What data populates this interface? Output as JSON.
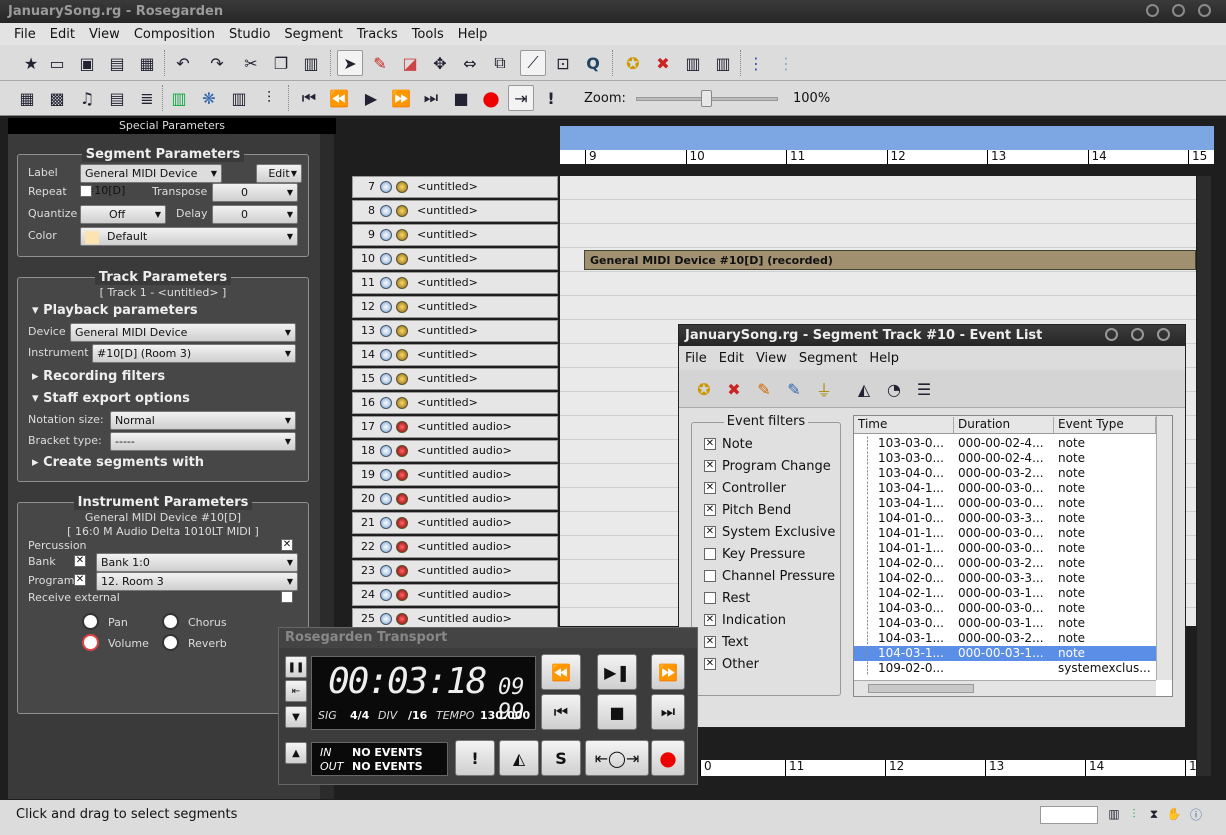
{
  "window": {
    "title": "JanuarySong.rg - Rosegarden"
  },
  "menu": [
    "File",
    "Edit",
    "View",
    "Composition",
    "Studio",
    "Segment",
    "Tracks",
    "Tools",
    "Help"
  ],
  "zoom": {
    "label": "Zoom:",
    "value": "100%",
    "level": 0.5
  },
  "left_panel": {
    "header": "Special Parameters",
    "segment": {
      "title": "Segment Parameters",
      "label_label": "Label",
      "label_value": "General MIDI Device #10[D]",
      "edit": "Edit",
      "repeat": "Repeat",
      "transpose": "Transpose",
      "transpose_value": "0",
      "quantize": "Quantize",
      "quantize_value": "Off",
      "delay": "Delay",
      "delay_value": "0",
      "color": "Color",
      "color_value": "Default"
    },
    "track": {
      "title": "Track Parameters",
      "subtitle": "[ Track 1 - <untitled> ]",
      "playback": "Playback parameters",
      "device": "Device",
      "device_value": "General MIDI Device",
      "instrument": "Instrument",
      "instrument_value": "#10[D] (Room 3)",
      "recording": "Recording filters",
      "staff": "Staff export options",
      "notation_size": "Notation size:",
      "notation_value": "Normal",
      "bracket_type": "Bracket type:",
      "bracket_value": "-----",
      "create": "Create segments with"
    },
    "instrument": {
      "title": "Instrument Parameters",
      "line1": "General MIDI Device  #10[D]",
      "line2": "[ 16:0 M Audio Delta 1010LT MIDI ]",
      "percussion": "Percussion",
      "bank": "Bank",
      "bank_value": "Bank 1:0",
      "program": "Program",
      "program_value": "12. Room 3",
      "receive": "Receive external",
      "pan": "Pan",
      "chorus": "Chorus",
      "volume": "Volume",
      "reverb": "Reverb"
    }
  },
  "tracks": [
    {
      "n": "7",
      "name": "<untitled>",
      "audio": false
    },
    {
      "n": "8",
      "name": "<untitled>",
      "audio": false
    },
    {
      "n": "9",
      "name": "<untitled>",
      "audio": false
    },
    {
      "n": "10",
      "name": "<untitled>",
      "audio": false
    },
    {
      "n": "11",
      "name": "<untitled>",
      "audio": false
    },
    {
      "n": "12",
      "name": "<untitled>",
      "audio": false
    },
    {
      "n": "13",
      "name": "<untitled>",
      "audio": false
    },
    {
      "n": "14",
      "name": "<untitled>",
      "audio": false
    },
    {
      "n": "15",
      "name": "<untitled>",
      "audio": false
    },
    {
      "n": "16",
      "name": "<untitled>",
      "audio": false
    },
    {
      "n": "17",
      "name": "<untitled audio>",
      "audio": true
    },
    {
      "n": "18",
      "name": "<untitled audio>",
      "audio": true
    },
    {
      "n": "19",
      "name": "<untitled audio>",
      "audio": true
    },
    {
      "n": "20",
      "name": "<untitled audio>",
      "audio": true
    },
    {
      "n": "21",
      "name": "<untitled audio>",
      "audio": true
    },
    {
      "n": "22",
      "name": "<untitled audio>",
      "audio": true
    },
    {
      "n": "23",
      "name": "<untitled audio>",
      "audio": true
    },
    {
      "n": "24",
      "name": "<untitled audio>",
      "audio": true
    },
    {
      "n": "25",
      "name": "<untitled audio>",
      "audio": true
    }
  ],
  "ruler": [
    "9",
    "10",
    "11",
    "12",
    "13",
    "14",
    "15"
  ],
  "bottom_ruler": [
    "0",
    "11",
    "12",
    "13",
    "14",
    "1"
  ],
  "segment_label": "General MIDI Device #10[D] (recorded)",
  "status": "Click and drag to select segments",
  "event_list": {
    "title": "JanuarySong.rg - Segment Track #10 - Event List",
    "menu": [
      "File",
      "Edit",
      "View",
      "Segment",
      "Help"
    ],
    "filters_title": "Event filters",
    "filters": [
      {
        "label": "Note",
        "checked": true
      },
      {
        "label": "Program Change",
        "checked": true
      },
      {
        "label": "Controller",
        "checked": true
      },
      {
        "label": "Pitch Bend",
        "checked": true
      },
      {
        "label": "System Exclusive",
        "checked": true
      },
      {
        "label": "Key Pressure",
        "checked": false
      },
      {
        "label": "Channel Pressure",
        "checked": false
      },
      {
        "label": "Rest",
        "checked": false
      },
      {
        "label": "Indication",
        "checked": true
      },
      {
        "label": "Text",
        "checked": true
      },
      {
        "label": "Other",
        "checked": true
      }
    ],
    "columns": [
      "Time",
      "Duration",
      "Event Type"
    ],
    "rows": [
      {
        "time": "103-03-0...",
        "dur": "000-00-02-4...",
        "type": "note"
      },
      {
        "time": "103-03-0...",
        "dur": "000-00-02-4...",
        "type": "note"
      },
      {
        "time": "103-04-0...",
        "dur": "000-00-03-2...",
        "type": "note"
      },
      {
        "time": "103-04-1...",
        "dur": "000-00-03-0...",
        "type": "note"
      },
      {
        "time": "103-04-1...",
        "dur": "000-00-03-0...",
        "type": "note"
      },
      {
        "time": "104-01-0...",
        "dur": "000-00-03-3...",
        "type": "note"
      },
      {
        "time": "104-01-1...",
        "dur": "000-00-03-0...",
        "type": "note"
      },
      {
        "time": "104-01-1...",
        "dur": "000-00-03-0...",
        "type": "note"
      },
      {
        "time": "104-02-0...",
        "dur": "000-00-03-2...",
        "type": "note"
      },
      {
        "time": "104-02-0...",
        "dur": "000-00-03-3...",
        "type": "note"
      },
      {
        "time": "104-02-1...",
        "dur": "000-00-03-1...",
        "type": "note"
      },
      {
        "time": "104-03-0...",
        "dur": "000-00-03-0...",
        "type": "note"
      },
      {
        "time": "104-03-0...",
        "dur": "000-00-03-1...",
        "type": "note"
      },
      {
        "time": "104-03-1...",
        "dur": "000-00-03-2...",
        "type": "note"
      },
      {
        "time": "104-03-1...",
        "dur": "000-00-03-1...",
        "type": "note",
        "selected": true
      },
      {
        "time": "109-02-0...",
        "dur": "",
        "type": "systemexclus..."
      }
    ]
  },
  "transport": {
    "title": "Rosegarden Transport",
    "time": "00:03:18",
    "sub": "09 99",
    "sig_label": "SIG",
    "sig": "4/4",
    "div_label": "DIV",
    "div": "/16",
    "tempo_label": "TEMPO",
    "tempo": "130.000",
    "in_label": "IN",
    "in": "NO EVENTS",
    "out_label": "OUT",
    "out": "NO EVENTS"
  }
}
